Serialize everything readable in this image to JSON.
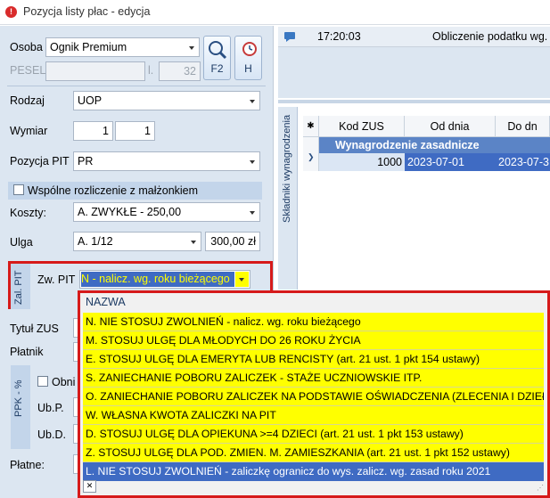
{
  "window": {
    "title": "Pozycja listy płac - edycja"
  },
  "form": {
    "osoba_label": "Osoba",
    "osoba_value": "Ognik Premium",
    "pesel_label": "PESEL",
    "l_label": "l.",
    "l_value": "32",
    "f2_label": "F2",
    "h_label": "H",
    "rodzaj_label": "Rodzaj",
    "rodzaj_value": "UOP",
    "wymiar_label": "Wymiar",
    "wymiar_num": "1",
    "wymiar_den": "1",
    "pozycja_pit_label": "Pozycja PIT",
    "pozycja_pit_value": "PR",
    "wspolne_label": "Wspólne rozliczenie z małżonkiem",
    "koszty_label": "Koszty:",
    "koszty_value": "A. ZWYKŁE - 250,00",
    "ulga_label": "Ulga",
    "ulga_value": "A. 1/12",
    "ulga_amount": "300,00 zł",
    "zal_pit_tab": "Zal. PIT",
    "zw_pit_label": "Zw. PIT",
    "zw_pit_value": "N - nalicz. wg. roku bieżącego",
    "tytul_zus_label": "Tytuł ZUS",
    "platnik_label": "Płatnik",
    "ppk_tab": "PPK - %",
    "obni_label": "Obni",
    "ubp_label": "Ub.P.",
    "ubd_label": "Ub.D.",
    "platne_label": "Płatne:"
  },
  "right": {
    "time": "17:20:03",
    "message": "Obliczenie podatku wg.",
    "side_tab": "Składniki wynagrodzenia",
    "columns": [
      "Kod ZUS",
      "Od dnia",
      "Do dn"
    ],
    "group_row": "Wynagrodzenie zasadnicze",
    "row": {
      "kod": "1000",
      "od": "2023-07-01",
      "do": "2023-07-3"
    }
  },
  "dropdown": {
    "header": "NAZWA",
    "items": [
      "N. NIE STOSUJ ZWOLNIEŃ - nalicz. wg. roku bieżącego",
      "M. STOSUJ ULGĘ DLA MŁODYCH DO 26 ROKU ŻYCIA",
      "E. STOSUJ ULGĘ DLA EMERYTA LUB RENCISTY (art. 21 ust. 1 pkt 154 ustawy)",
      "S. ZANIECHANIE POBORU ZALICZEK - STAŻE UCZNIOWSKIE ITP.",
      "O. ZANIECHANIE POBORU ZALICZEK NA PODSTAWIE OŚWIADCZENIA (ZLECENIA I DZIEŁA)",
      "W. WŁASNA KWOTA ZALICZKI NA PIT",
      "D. STOSUJ ULGĘ DLA OPIEKUNA >=4 DZIECI (art. 21 ust. 1 pkt 153 ustawy)",
      "Z. STOSUJ ULGĘ DLA POD. ZMIEN. M. ZAMIESZKANIA  (art. 21 ust. 1 pkt 152 ustawy)",
      "L. NIE STOSUJ ZWOLNIEŃ - zaliczkę ogranicz do wys. zalicz. wg. zasad roku 2021"
    ],
    "selected_index": 8,
    "close_glyph": "✕"
  },
  "colors": {
    "highlight_yellow": "#ffff00",
    "selection_blue": "#3f6bc3",
    "annotation_red": "#d61a1a"
  }
}
